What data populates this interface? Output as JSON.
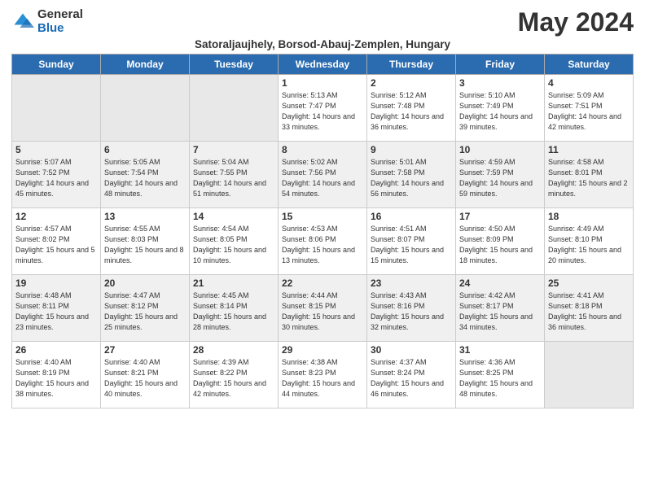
{
  "logo": {
    "general": "General",
    "blue": "Blue"
  },
  "header": {
    "month_year": "May 2024",
    "location": "Satoraljaujhely, Borsod-Abauj-Zemplen, Hungary"
  },
  "days_of_week": [
    "Sunday",
    "Monday",
    "Tuesday",
    "Wednesday",
    "Thursday",
    "Friday",
    "Saturday"
  ],
  "weeks": [
    [
      {
        "day": "",
        "info": ""
      },
      {
        "day": "",
        "info": ""
      },
      {
        "day": "",
        "info": ""
      },
      {
        "day": "1",
        "info": "Sunrise: 5:13 AM\nSunset: 7:47 PM\nDaylight: 14 hours\nand 33 minutes."
      },
      {
        "day": "2",
        "info": "Sunrise: 5:12 AM\nSunset: 7:48 PM\nDaylight: 14 hours\nand 36 minutes."
      },
      {
        "day": "3",
        "info": "Sunrise: 5:10 AM\nSunset: 7:49 PM\nDaylight: 14 hours\nand 39 minutes."
      },
      {
        "day": "4",
        "info": "Sunrise: 5:09 AM\nSunset: 7:51 PM\nDaylight: 14 hours\nand 42 minutes."
      }
    ],
    [
      {
        "day": "5",
        "info": "Sunrise: 5:07 AM\nSunset: 7:52 PM\nDaylight: 14 hours\nand 45 minutes."
      },
      {
        "day": "6",
        "info": "Sunrise: 5:05 AM\nSunset: 7:54 PM\nDaylight: 14 hours\nand 48 minutes."
      },
      {
        "day": "7",
        "info": "Sunrise: 5:04 AM\nSunset: 7:55 PM\nDaylight: 14 hours\nand 51 minutes."
      },
      {
        "day": "8",
        "info": "Sunrise: 5:02 AM\nSunset: 7:56 PM\nDaylight: 14 hours\nand 54 minutes."
      },
      {
        "day": "9",
        "info": "Sunrise: 5:01 AM\nSunset: 7:58 PM\nDaylight: 14 hours\nand 56 minutes."
      },
      {
        "day": "10",
        "info": "Sunrise: 4:59 AM\nSunset: 7:59 PM\nDaylight: 14 hours\nand 59 minutes."
      },
      {
        "day": "11",
        "info": "Sunrise: 4:58 AM\nSunset: 8:01 PM\nDaylight: 15 hours\nand 2 minutes."
      }
    ],
    [
      {
        "day": "12",
        "info": "Sunrise: 4:57 AM\nSunset: 8:02 PM\nDaylight: 15 hours\nand 5 minutes."
      },
      {
        "day": "13",
        "info": "Sunrise: 4:55 AM\nSunset: 8:03 PM\nDaylight: 15 hours\nand 8 minutes."
      },
      {
        "day": "14",
        "info": "Sunrise: 4:54 AM\nSunset: 8:05 PM\nDaylight: 15 hours\nand 10 minutes."
      },
      {
        "day": "15",
        "info": "Sunrise: 4:53 AM\nSunset: 8:06 PM\nDaylight: 15 hours\nand 13 minutes."
      },
      {
        "day": "16",
        "info": "Sunrise: 4:51 AM\nSunset: 8:07 PM\nDaylight: 15 hours\nand 15 minutes."
      },
      {
        "day": "17",
        "info": "Sunrise: 4:50 AM\nSunset: 8:09 PM\nDaylight: 15 hours\nand 18 minutes."
      },
      {
        "day": "18",
        "info": "Sunrise: 4:49 AM\nSunset: 8:10 PM\nDaylight: 15 hours\nand 20 minutes."
      }
    ],
    [
      {
        "day": "19",
        "info": "Sunrise: 4:48 AM\nSunset: 8:11 PM\nDaylight: 15 hours\nand 23 minutes."
      },
      {
        "day": "20",
        "info": "Sunrise: 4:47 AM\nSunset: 8:12 PM\nDaylight: 15 hours\nand 25 minutes."
      },
      {
        "day": "21",
        "info": "Sunrise: 4:45 AM\nSunset: 8:14 PM\nDaylight: 15 hours\nand 28 minutes."
      },
      {
        "day": "22",
        "info": "Sunrise: 4:44 AM\nSunset: 8:15 PM\nDaylight: 15 hours\nand 30 minutes."
      },
      {
        "day": "23",
        "info": "Sunrise: 4:43 AM\nSunset: 8:16 PM\nDaylight: 15 hours\nand 32 minutes."
      },
      {
        "day": "24",
        "info": "Sunrise: 4:42 AM\nSunset: 8:17 PM\nDaylight: 15 hours\nand 34 minutes."
      },
      {
        "day": "25",
        "info": "Sunrise: 4:41 AM\nSunset: 8:18 PM\nDaylight: 15 hours\nand 36 minutes."
      }
    ],
    [
      {
        "day": "26",
        "info": "Sunrise: 4:40 AM\nSunset: 8:19 PM\nDaylight: 15 hours\nand 38 minutes."
      },
      {
        "day": "27",
        "info": "Sunrise: 4:40 AM\nSunset: 8:21 PM\nDaylight: 15 hours\nand 40 minutes."
      },
      {
        "day": "28",
        "info": "Sunrise: 4:39 AM\nSunset: 8:22 PM\nDaylight: 15 hours\nand 42 minutes."
      },
      {
        "day": "29",
        "info": "Sunrise: 4:38 AM\nSunset: 8:23 PM\nDaylight: 15 hours\nand 44 minutes."
      },
      {
        "day": "30",
        "info": "Sunrise: 4:37 AM\nSunset: 8:24 PM\nDaylight: 15 hours\nand 46 minutes."
      },
      {
        "day": "31",
        "info": "Sunrise: 4:36 AM\nSunset: 8:25 PM\nDaylight: 15 hours\nand 48 minutes."
      },
      {
        "day": "",
        "info": ""
      }
    ]
  ]
}
